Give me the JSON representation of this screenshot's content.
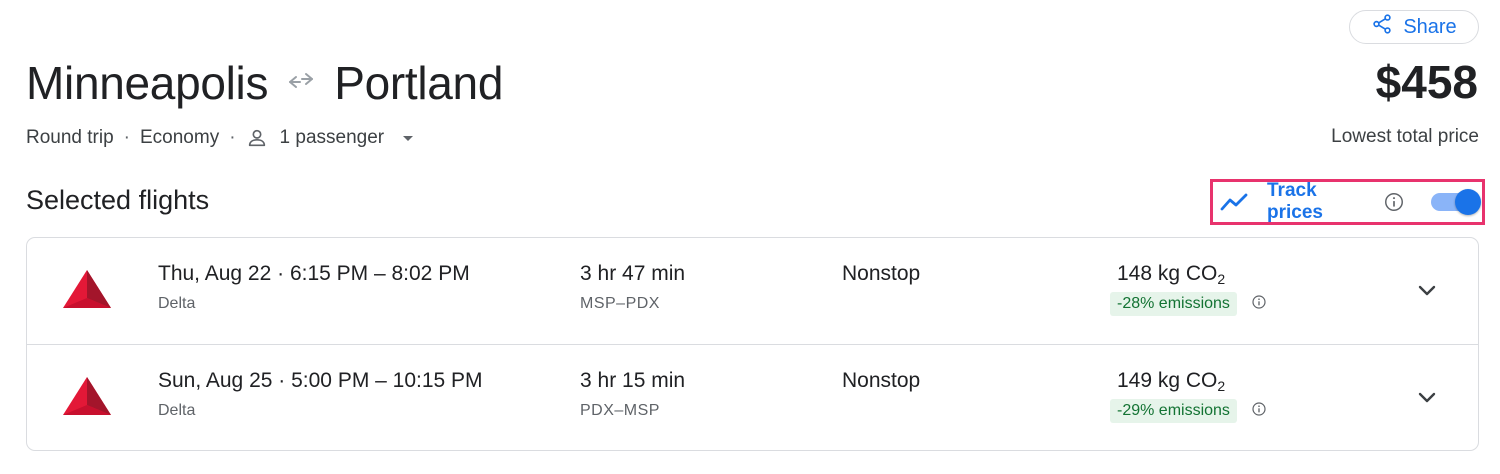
{
  "header": {
    "share_label": "Share",
    "origin": "Minneapolis",
    "destination": "Portland",
    "price": "$458",
    "price_caption": "Lowest total price"
  },
  "trip_options": {
    "trip_type": "Round trip",
    "cabin_class": "Economy",
    "passengers": "1 passenger",
    "separator": "·"
  },
  "selected": {
    "title": "Selected flights",
    "track_label": "Track prices",
    "track_enabled": true
  },
  "flights": [
    {
      "date": "Thu, Aug 22",
      "times": "6:15 PM – 8:02 PM",
      "airline": "Delta",
      "duration": "3 hr 47 min",
      "route": "MSP–PDX",
      "stops": "Nonstop",
      "co2_value": "148 kg CO",
      "co2_sub": "2",
      "emissions": "-28% emissions"
    },
    {
      "date": "Sun, Aug 25",
      "times": "5:00 PM – 10:15 PM",
      "airline": "Delta",
      "duration": "3 hr 15 min",
      "route": "PDX–MSP",
      "stops": "Nonstop",
      "co2_value": "149 kg CO",
      "co2_sub": "2",
      "emissions": "-29% emissions"
    }
  ],
  "colors": {
    "accent": "#1a73e8",
    "highlight_border": "#e8336d",
    "emissions_bg": "#e6f4ea",
    "emissions_text": "#137333",
    "delta_red": "#c8102e"
  },
  "icons": {
    "share": "share-icon",
    "swap": "swap-arrows-icon",
    "person": "person-icon",
    "dropdown": "caret-down-icon",
    "trend": "trending-icon",
    "info": "info-icon",
    "expand": "chevron-down-icon",
    "airline": "delta-logo"
  }
}
